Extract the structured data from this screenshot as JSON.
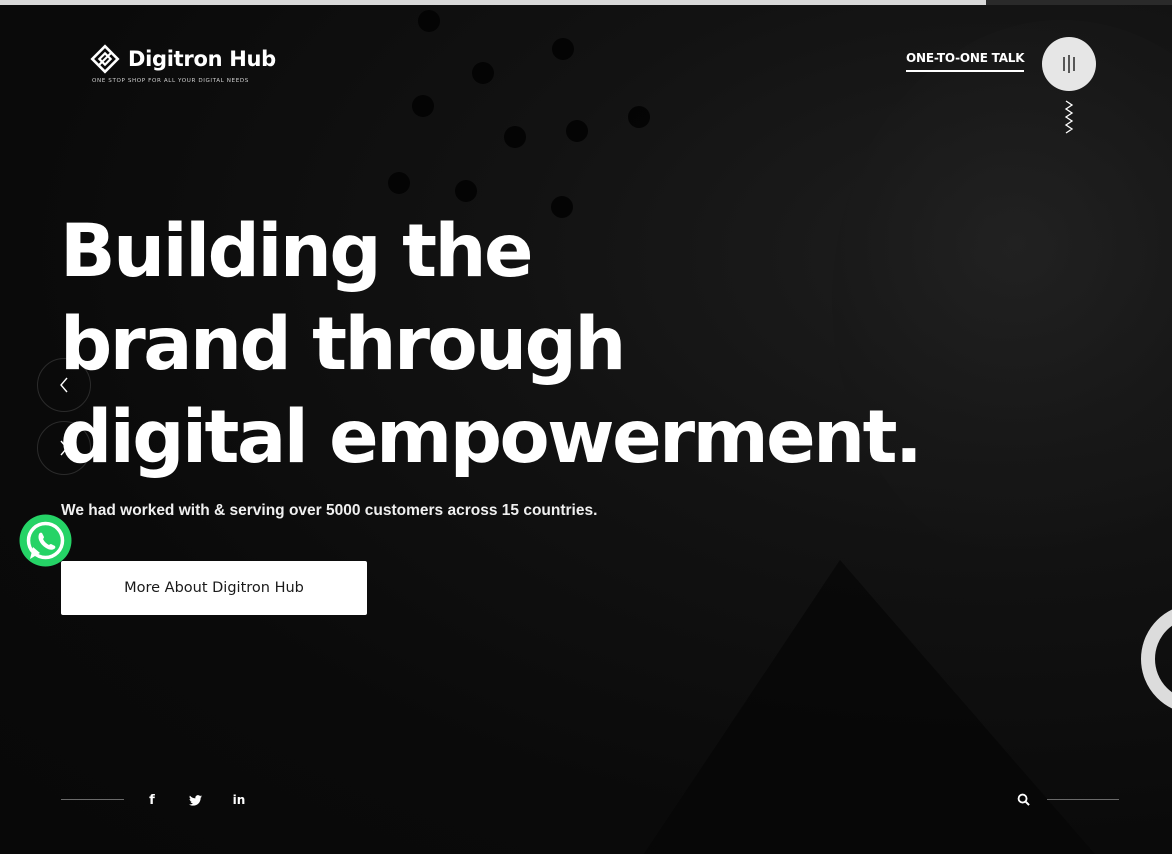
{
  "brand": {
    "name": "Digitron Hub",
    "tagline": "ONE STOP SHOP FOR ALL YOUR DIGITAL NEEDS",
    "logo_icon": "diamond-logo-icon"
  },
  "header": {
    "talk_link": "ONE-TO-ONE TALK",
    "menu_icon": "menu-bars-icon"
  },
  "hero": {
    "title_lines": [
      "Building the",
      "brand through",
      "digital empowerment."
    ],
    "subtitle": "We had worked with & serving over 5000 customers across 15 countries.",
    "cta_label": "More About Digitron Hub"
  },
  "social": {
    "facebook": "f",
    "twitter": "twitter-icon",
    "linkedin": "in"
  },
  "colors": {
    "background": "#0b0b0b",
    "text": "#ffffff",
    "button_bg": "#ffffff",
    "whatsapp": "#25d366"
  }
}
